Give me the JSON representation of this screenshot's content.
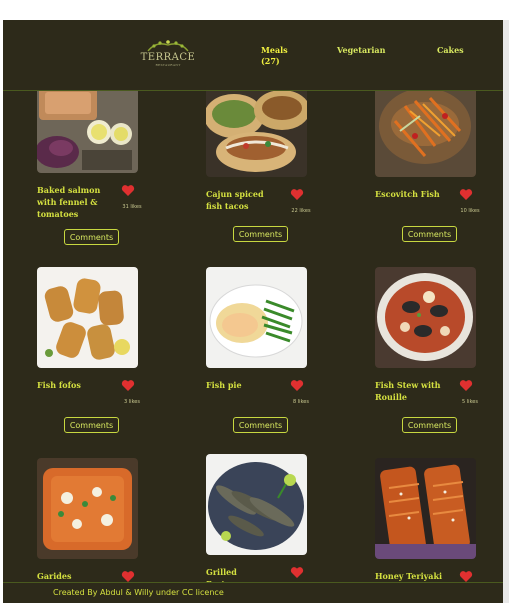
{
  "header": {
    "logo_text": "TERRACE",
    "logo_sub": "RESTAURANT",
    "nav": [
      {
        "label": "Meals",
        "count": "(27)"
      },
      {
        "label": "Vegetarian"
      },
      {
        "label": "Cakes"
      }
    ]
  },
  "meals": [
    {
      "name": "Baked salmon with fennel & tomatoes",
      "likes": "31 likes"
    },
    {
      "name": "Cajun spiced fish tacos",
      "likes": "22 likes"
    },
    {
      "name": "Escovitch Fish",
      "likes": "10 likes"
    },
    {
      "name": "Fish fofos",
      "likes": "3 likes"
    },
    {
      "name": "Fish pie",
      "likes": "8 likes"
    },
    {
      "name": "Fish Stew with Rouille",
      "likes": "5 likes"
    },
    {
      "name": "Garides",
      "likes": ""
    },
    {
      "name": "Grilled Portuguese",
      "likes": ""
    },
    {
      "name": "Honey Teriyaki",
      "likes": ""
    }
  ],
  "comments_label": "Comments",
  "footer": {
    "text": "Created By Abdul & Willy under CC licence"
  },
  "colors": {
    "background": "#2d2a1a",
    "accent": "#d4e040",
    "heart": "#e03030"
  }
}
